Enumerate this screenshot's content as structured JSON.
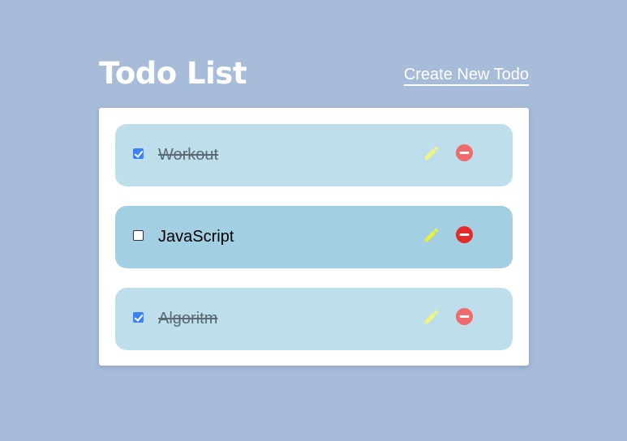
{
  "header": {
    "title": "Todo List",
    "create_link": "Create New Todo"
  },
  "todos": [
    {
      "text": "Workout",
      "completed": true
    },
    {
      "text": "JavaScript",
      "completed": false
    },
    {
      "text": "Algoritm",
      "completed": true
    }
  ],
  "icons": {
    "edit": "pencil-icon",
    "delete": "minus-circle-icon"
  },
  "colors": {
    "background": "#a7bcd9",
    "card": "#ffffff",
    "item_done": "#bfdeeb",
    "item_active": "#a2d0e2",
    "checkbox_checked": "#3b82f6",
    "edit_icon_done": "#f0f57a",
    "edit_icon_active": "#e6f03c",
    "delete_icon_done": "#f06b6b",
    "delete_icon_active": "#e52a2a"
  }
}
